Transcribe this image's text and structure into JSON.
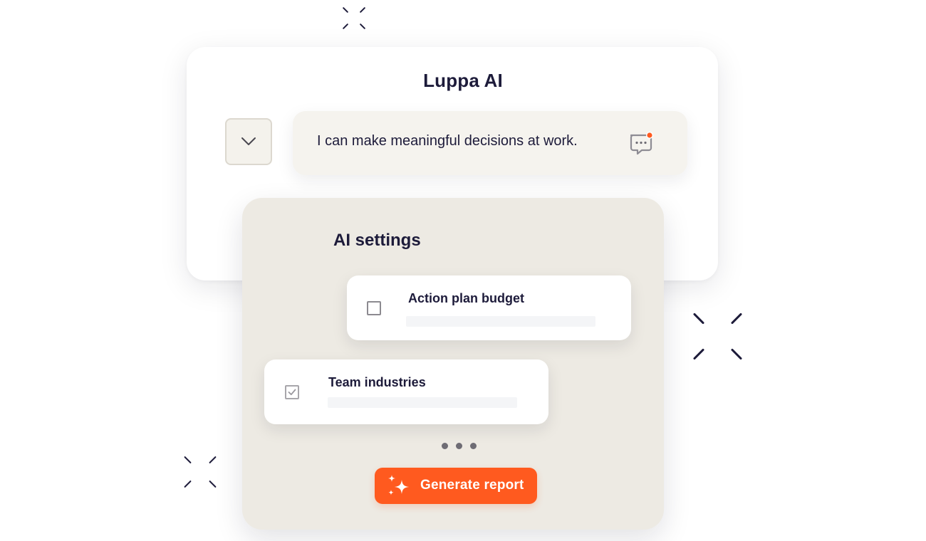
{
  "assistant_card": {
    "title": "Luppa AI",
    "message": "I can make meaningful decisions at work.",
    "expand_icon": "chevron-down-icon",
    "chat_icon": "chat-bubble-notification-icon"
  },
  "settings_panel": {
    "title": "AI settings",
    "options": [
      {
        "label": "Action plan budget",
        "checked": false
      },
      {
        "label": "Team industries",
        "checked": true
      }
    ],
    "more_icon": "ellipsis-icon",
    "generate_button": {
      "label": "Generate report",
      "icon": "sparkles-icon"
    }
  },
  "colors": {
    "accent": "#ff5a1f",
    "text": "#1d1b3a",
    "panel_bg": "#edeae3",
    "bubble_bg": "#f5f3ee",
    "notification_dot": "#ff5a1f"
  }
}
